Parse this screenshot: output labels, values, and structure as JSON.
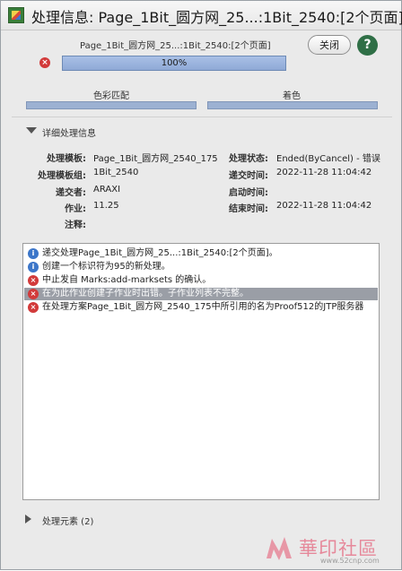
{
  "window": {
    "title": "处理信息: Page_1Bit_圆方网_25...:1Bit_2540:[2个页面]",
    "caption": "Page_1Bit_圆方网_25...:1Bit_2540:[2个页面]",
    "close_label": "关闭",
    "help_label": "?"
  },
  "progress": {
    "value": 1.0,
    "label": "100%"
  },
  "steps": [
    {
      "label": "色彩匹配",
      "progress": 1.0
    },
    {
      "label": "着色",
      "progress": 1.0
    }
  ],
  "details": {
    "title": "详细处理信息",
    "left": [
      {
        "key": "处理模板:",
        "value": "Page_1Bit_圆方网_2540_175"
      },
      {
        "key": "处理模板组:",
        "value": "1Bit_2540"
      },
      {
        "key": "递交者:",
        "value": "ARAXI"
      },
      {
        "key": "作业:",
        "value": "11.25"
      },
      {
        "key": "注释:",
        "value": ""
      }
    ],
    "right": [
      {
        "key": "处理状态:",
        "value": "Ended(ByCancel) - 错误"
      },
      {
        "key": "递交时间:",
        "value": "2022-11-28 11:04:42"
      },
      {
        "key": "启动时间:",
        "value": ""
      },
      {
        "key": "结束时间:",
        "value": "2022-11-28 11:04:42"
      }
    ]
  },
  "log": [
    {
      "type": "info",
      "icon": "info-icon",
      "text": "递交处理Page_1Bit_圆方网_25...:1Bit_2540:[2个页面]。"
    },
    {
      "type": "info",
      "icon": "info-icon",
      "text": "创建一个标识符为95的新处理。"
    },
    {
      "type": "error",
      "icon": "error-icon",
      "text": "中止发自 Marks:add-marksets 的确认。"
    },
    {
      "type": "error",
      "icon": "error-icon",
      "text": "在为此作业创建子作业时出错。子作业列表不完整。",
      "selected": true
    },
    {
      "type": "error",
      "icon": "error-icon",
      "text": "在处理方案Page_1Bit_圆方网_2540_175中所引用的名为Proof512的JTP服务器"
    }
  ],
  "elements_section": {
    "label": "处理元素 (2)"
  },
  "watermark": {
    "text": "華印社區",
    "url": "www.52cnp.com"
  },
  "colors": {
    "progress": "#9cb1d2",
    "error": "#d23a3a",
    "info": "#3c76c9",
    "selected_row": "#9a9ea6"
  }
}
